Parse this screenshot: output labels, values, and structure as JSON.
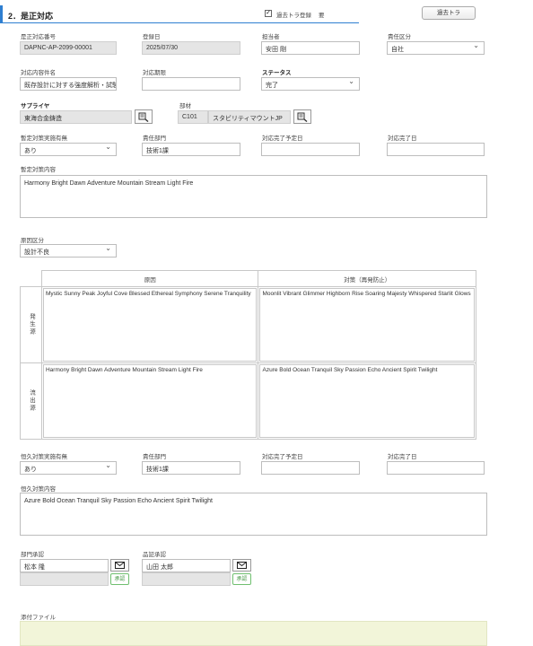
{
  "section": {
    "title": "2．是正対応"
  },
  "header_controls": {
    "past_trouble_check_label": "過去トラ登録",
    "past_trouble_required": "要",
    "past_trouble_button": "過去トラ",
    "checked": true
  },
  "row1": {
    "corrective_no_label": "是正対応番号",
    "corrective_no": "DAPNC-AP-2099-00001",
    "registered_date_label": "登録日",
    "registered_date": "2025/07/30",
    "person_label": "担当者",
    "person": "安田 剛",
    "responsibility_label": "責任区分",
    "responsibility": "自社"
  },
  "row2": {
    "content_name_label": "対応内容件名",
    "content_name": "既存設計に対する強度解析・試験",
    "deadline_label": "対応期限",
    "deadline": "",
    "status_label": "ステータス",
    "status": "完了"
  },
  "row3": {
    "supplier_label": "サプライヤ",
    "supplier": "東海合金鋳造",
    "part_label": "部材",
    "part_code": "C101",
    "part_name": "スタビリティマウントJP"
  },
  "temp": {
    "measure_label": "暫定対策実施有無",
    "measure": "あり",
    "dept_label": "責任部門",
    "dept": "技術1課",
    "planned_label": "対応完了予定日",
    "planned": "",
    "done_label": "対応完了日",
    "done": "",
    "content_label": "暫定対策内容",
    "content": "Harmony Bright Dawn Adventure Mountain Stream Light Fire"
  },
  "cause_category": {
    "label": "原因区分",
    "value": "設計不良"
  },
  "cause_table": {
    "col_cause": "原因",
    "col_measure": "対策（再発防止）",
    "rows": [
      {
        "label": "発生源",
        "cause": "Mystic Sunny Peak Joyful Cove Blessed Ethereal Symphony Serene Tranquility",
        "measure": "Moonlit Vibrant Glimmer Highborn Rise Soaring Majesty Whispered Starlit Glows"
      },
      {
        "label": "流出源",
        "cause": "Harmony Bright Dawn Adventure Mountain Stream Light Fire",
        "measure": "Azure Bold Ocean Tranquil Sky Passion Echo Ancient Spirit Twilight"
      }
    ]
  },
  "perm": {
    "measure_label": "恒久対策実施有無",
    "measure": "あり",
    "dept_label": "責任部門",
    "dept": "技術1課",
    "planned_label": "対応完了予定日",
    "planned": "",
    "done_label": "対応完了日",
    "done": "",
    "content_label": "恒久対策内容",
    "content": "Azure Bold Ocean Tranquil Sky Passion Echo Ancient Spirit Twilight"
  },
  "approval": {
    "dept_label": "部門承認",
    "dept_person": "松本 隆",
    "qa_label": "品証承認",
    "qa_person": "山田 太郎",
    "approve_label": "承認"
  },
  "attachment": {
    "label": "添付ファイル"
  },
  "colors": {
    "accent": "#2f7fd1",
    "approve": "#4a9a4a",
    "attach_bg": "#f2f5d9"
  }
}
